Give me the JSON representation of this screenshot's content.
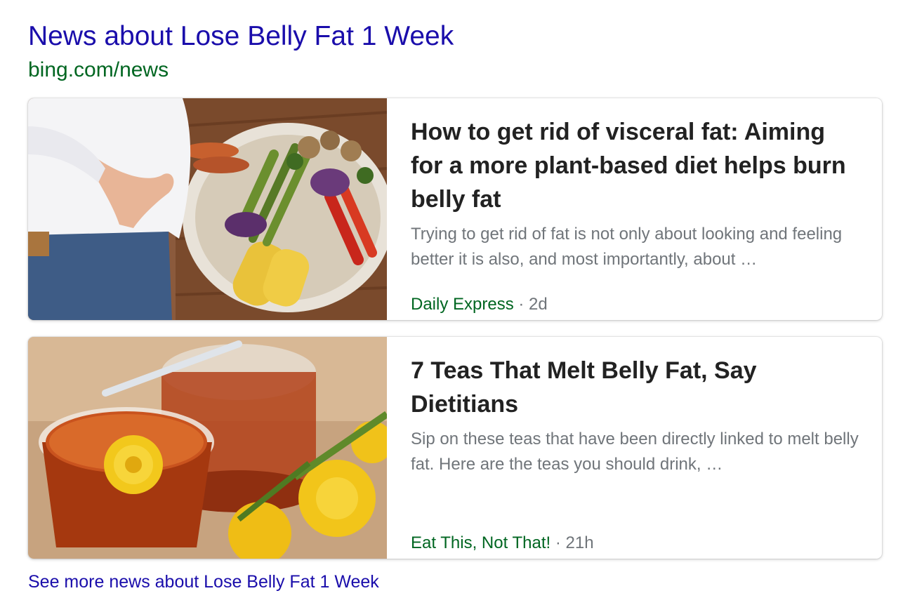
{
  "header": {
    "title": "News about Lose Belly Fat 1 Week",
    "source": "bing.com/news"
  },
  "articles": [
    {
      "headline": "How to get rid of visceral fat: Aiming for a more plant-based diet helps burn belly fat",
      "snippet": "Trying to get rid of fat is not only about looking and feeling better it is also, and most importantly, about …",
      "source": "Daily Express",
      "separator": " · ",
      "age": "2d"
    },
    {
      "headline": "7 Teas That Melt Belly Fat, Say Dietitians",
      "snippet": "Sip on these teas that have been directly linked to melt belly fat. Here are the teas you should drink, …",
      "source": "Eat This, Not That!",
      "separator": " · ",
      "age": "21h"
    }
  ],
  "footer": {
    "more_link": "See more news about Lose Belly Fat 1 Week"
  },
  "colors": {
    "link": "#1a0dab",
    "source": "#006621",
    "snippet": "#70757a",
    "headline": "#222222"
  }
}
